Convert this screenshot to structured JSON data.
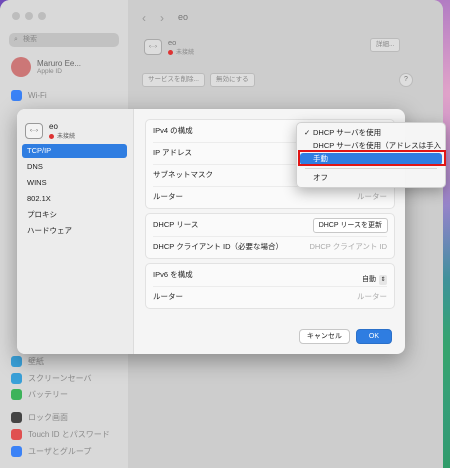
{
  "sidebar": {
    "search_placeholder": "検索",
    "user_name": "Maruro Ee...",
    "user_sub": "Apple ID",
    "items_top": [
      {
        "label": "Wi-Fi",
        "color": "#3b82f6"
      }
    ],
    "items_bottom": [
      {
        "label": "壁紙",
        "color": "#3aa0d8"
      },
      {
        "label": "スクリーンセーバ",
        "color": "#3aa0d8"
      },
      {
        "label": "バッテリー",
        "color": "#3db35a"
      },
      {
        "label": "ロック画面",
        "color": "#444444"
      },
      {
        "label": "Touch ID とパスワード",
        "color": "#e05050"
      },
      {
        "label": "ユーザとグループ",
        "color": "#3b82f6"
      }
    ]
  },
  "main": {
    "nav_title": "eo",
    "service_name": "eo",
    "service_status": "未接続",
    "details_button": "詳細...",
    "delete_service_button": "サービスを削除...",
    "disable_button": "無効にする",
    "help_label": "?"
  },
  "dialog": {
    "service_name": "eo",
    "service_status": "未接続",
    "service_icon_text": "‹··›",
    "tabs": [
      "TCP/IP",
      "DNS",
      "WINS",
      "802.1X",
      "プロキシ",
      "ハードウェア"
    ],
    "active_tab": "TCP/IP",
    "panel1": {
      "ipv4_label": "IPv4 の構成",
      "ip_label": "IP アドレス",
      "subnet_label": "サブネットマスク",
      "router_label": "ルーター",
      "router_placeholder": "ルーター"
    },
    "panel2": {
      "dhcp_lease_label": "DHCP リース",
      "dhcp_renew_button": "DHCP リースを更新",
      "dhcp_client_label": "DHCP クライアント ID（必要な場合）",
      "dhcp_client_placeholder": "DHCP クライアント ID"
    },
    "panel3": {
      "ipv6_label": "IPv6 を構成",
      "ipv6_value": "自動",
      "router_label": "ルーター",
      "router_placeholder": "ルーター"
    },
    "cancel_button": "キャンセル",
    "ok_button": "OK"
  },
  "ipv4_menu": {
    "options": [
      {
        "label": "DHCP サーバを使用",
        "checked": true
      },
      {
        "label": "DHCP サーバを使用（アドレスは手入力）",
        "checked": false
      },
      {
        "label": "手動",
        "checked": false,
        "highlighted": true
      },
      {
        "label": "オフ",
        "checked": false
      }
    ],
    "check_mark": "✓"
  },
  "colors": {
    "accent": "#2f7de1",
    "highlight_box": "#e01515"
  }
}
